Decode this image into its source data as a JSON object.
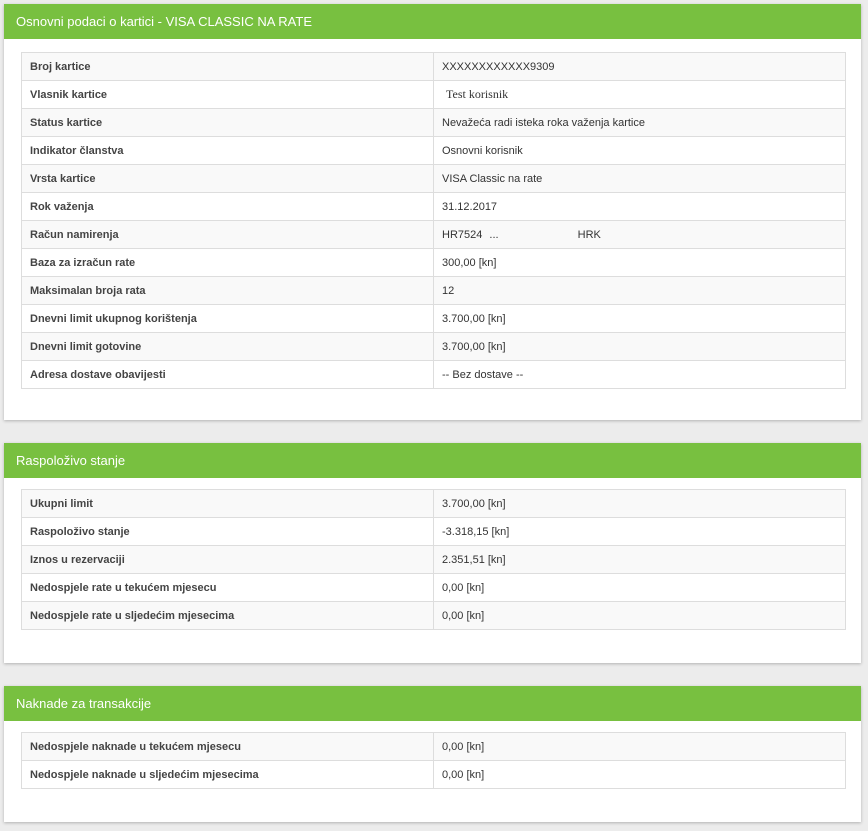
{
  "card_info": {
    "title": "Osnovni podaci o kartici - VISA CLASSIC NA RATE",
    "rows": [
      {
        "label": "Broj kartice",
        "value": "XXXXXXXXXXXX9309"
      },
      {
        "label": "Vlasnik kartice",
        "value": "Test korisnik"
      },
      {
        "label": "Status kartice",
        "value": "Nevažeća radi isteka roka važenja kartice"
      },
      {
        "label": "Indikator članstva",
        "value": "Osnovni korisnik"
      },
      {
        "label": "Vrsta kartice",
        "value": "VISA Classic na rate"
      },
      {
        "label": "Rok važenja",
        "value": "31.12.2017"
      },
      {
        "label": "Račun namirenja",
        "value": "HR7524",
        "value_mid": "...",
        "value_currency": "HRK"
      },
      {
        "label": "Baza za izračun rate",
        "value": "300,00 [kn]"
      },
      {
        "label": "Maksimalan broja rata",
        "value": "12"
      },
      {
        "label": "Dnevni limit ukupnog korištenja",
        "value": "3.700,00 [kn]"
      },
      {
        "label": "Dnevni limit gotovine",
        "value": "3.700,00 [kn]"
      },
      {
        "label": "Adresa dostave obavijesti",
        "value": "-- Bez dostave --"
      }
    ]
  },
  "balance": {
    "title": "Raspoloživo stanje",
    "rows": [
      {
        "label": "Ukupni limit",
        "value": "3.700,00 [kn]"
      },
      {
        "label": "Raspoloživo stanje",
        "value": "-3.318,15 [kn]"
      },
      {
        "label": "Iznos u rezervaciji",
        "value": "2.351,51 [kn]"
      },
      {
        "label": "Nedospjele rate u tekućem mjesecu",
        "value": "0,00 [kn]"
      },
      {
        "label": "Nedospjele rate u sljedećim mjesecima",
        "value": "0,00 [kn]"
      }
    ]
  },
  "fees": {
    "title": "Naknade za transakcije",
    "rows": [
      {
        "label": "Nedospjele naknade u tekućem mjesecu",
        "value": "0,00 [kn]"
      },
      {
        "label": "Nedospjele naknade u sljedećim mjesecima",
        "value": "0,00 [kn]"
      }
    ]
  },
  "colors": {
    "header_green": "#78c040",
    "background": "#ececec"
  }
}
